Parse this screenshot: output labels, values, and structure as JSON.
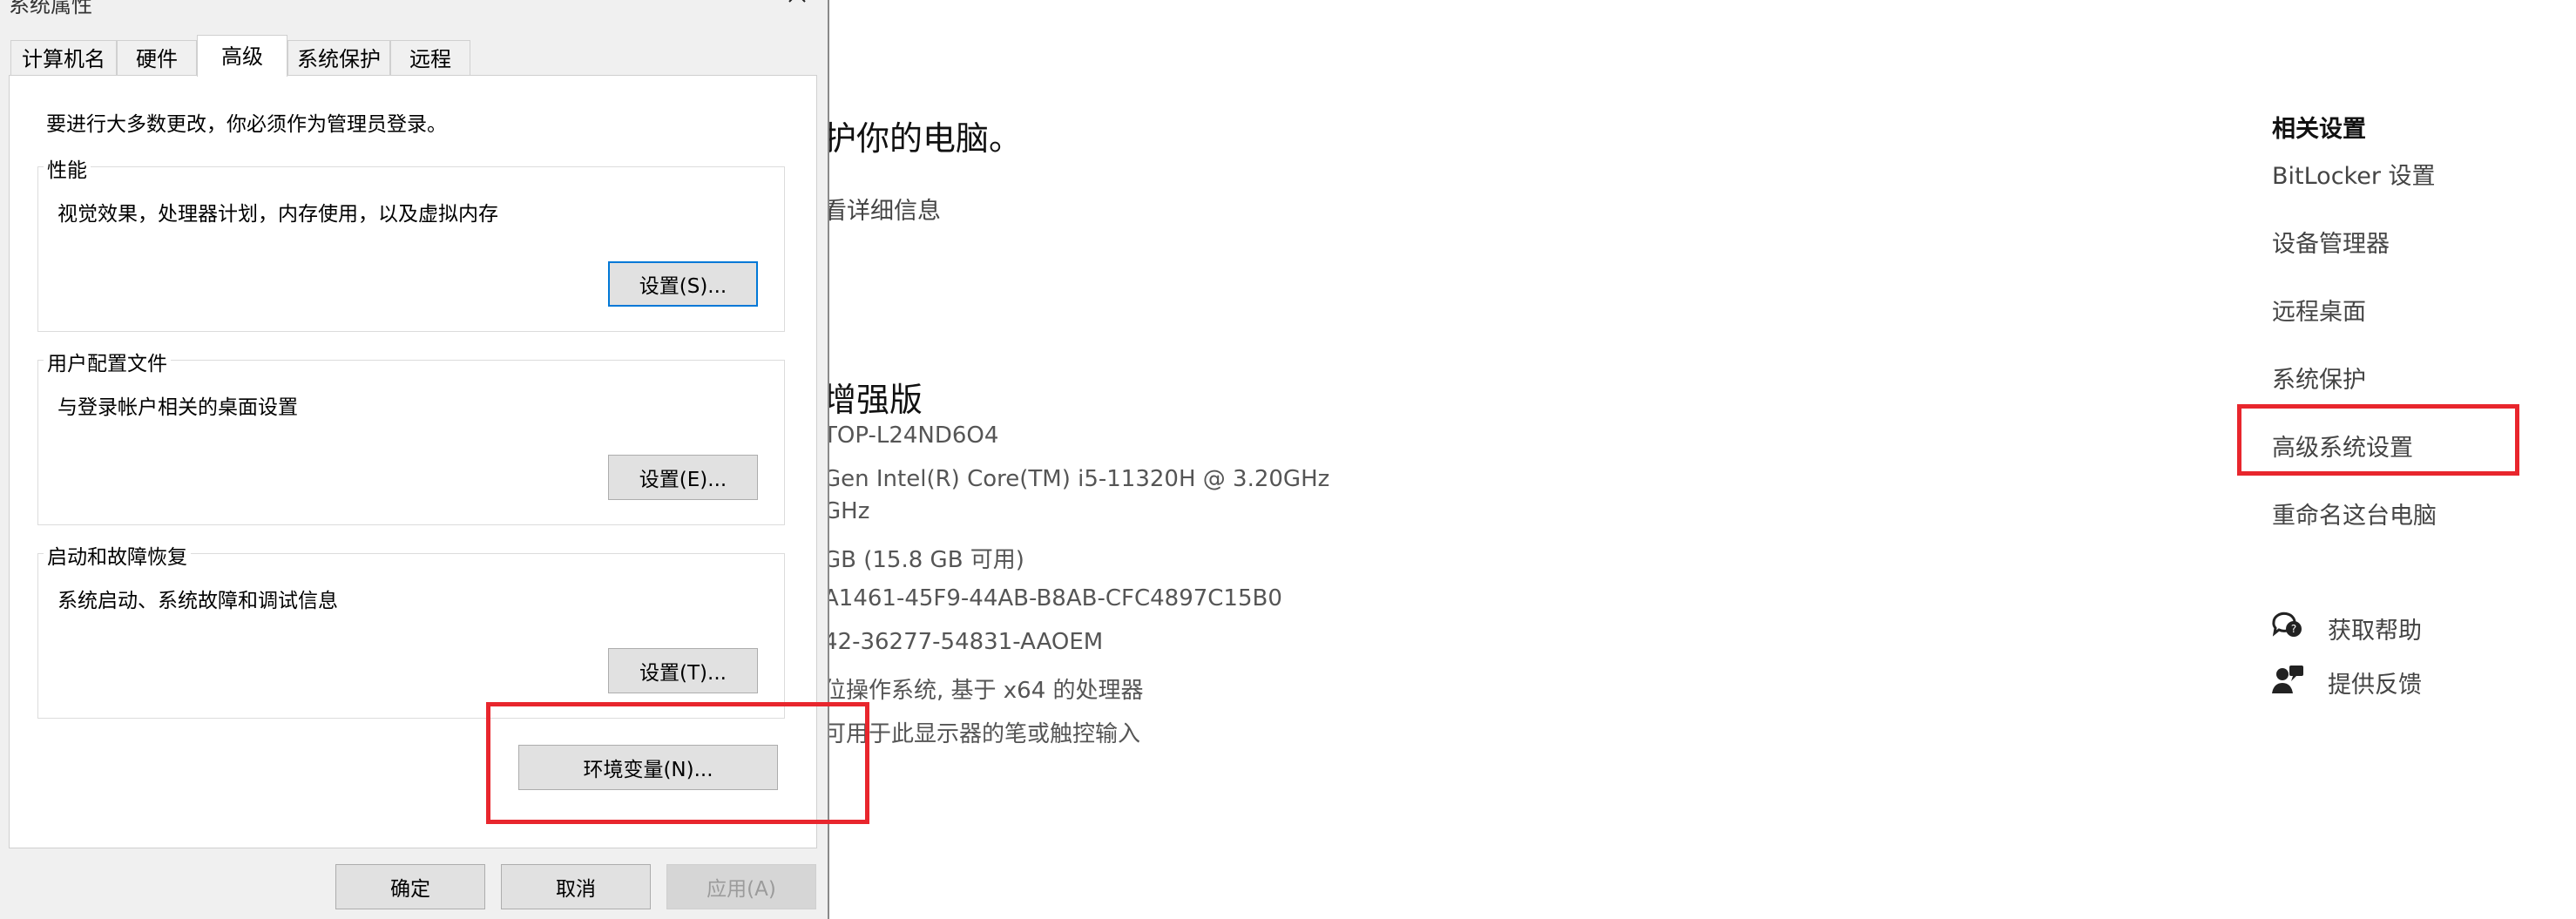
{
  "dialog": {
    "title": "系统属性",
    "tabs": [
      {
        "label": "计算机名"
      },
      {
        "label": "硬件"
      },
      {
        "label": "高级"
      },
      {
        "label": "系统保护"
      },
      {
        "label": "远程"
      }
    ],
    "active_tab": "高级",
    "admin_notice": "要进行大多数更改，你必须作为管理员登录。",
    "performance": {
      "title": "性能",
      "description": "视觉效果，处理器计划，内存使用，以及虚拟内存",
      "button": "设置(S)..."
    },
    "user_profiles": {
      "title": "用户配置文件",
      "description": "与登录帐户相关的桌面设置",
      "button": "设置(E)..."
    },
    "startup_recovery": {
      "title": "启动和故障恢复",
      "description": "系统启动、系统故障和调试信息",
      "button": "设置(T)..."
    },
    "env_button": "环境变量(N)...",
    "footer": {
      "ok": "确定",
      "cancel": "取消",
      "apply": "应用(A)"
    }
  },
  "settings_page": {
    "protect_heading": "护你的电脑。",
    "view_details": "看详细信息",
    "edition_heading": "增强版",
    "specs": [
      "TOP-L24ND6O4",
      "Gen Intel(R) Core(TM) i5-11320H @ 3.20GHz",
      "GHz",
      "GB (15.8 GB 可用)",
      "A1461-45F9-44AB-B8AB-CFC4897C15B0",
      "42-36277-54831-AAOEM",
      "位操作系统, 基于 x64 的处理器",
      "可用于此显示器的笔或触控输入"
    ],
    "related": {
      "title": "相关设置",
      "links": [
        "BitLocker 设置",
        "设备管理器",
        "远程桌面",
        "系统保护",
        "高级系统设置",
        "重命名这台电脑"
      ]
    },
    "help": {
      "get_help": "获取帮助",
      "feedback": "提供反馈"
    }
  },
  "colors": {
    "highlight_box": "#e8262d",
    "focus_border": "#0078d7",
    "dialog_bg": "#f0f0f0"
  }
}
